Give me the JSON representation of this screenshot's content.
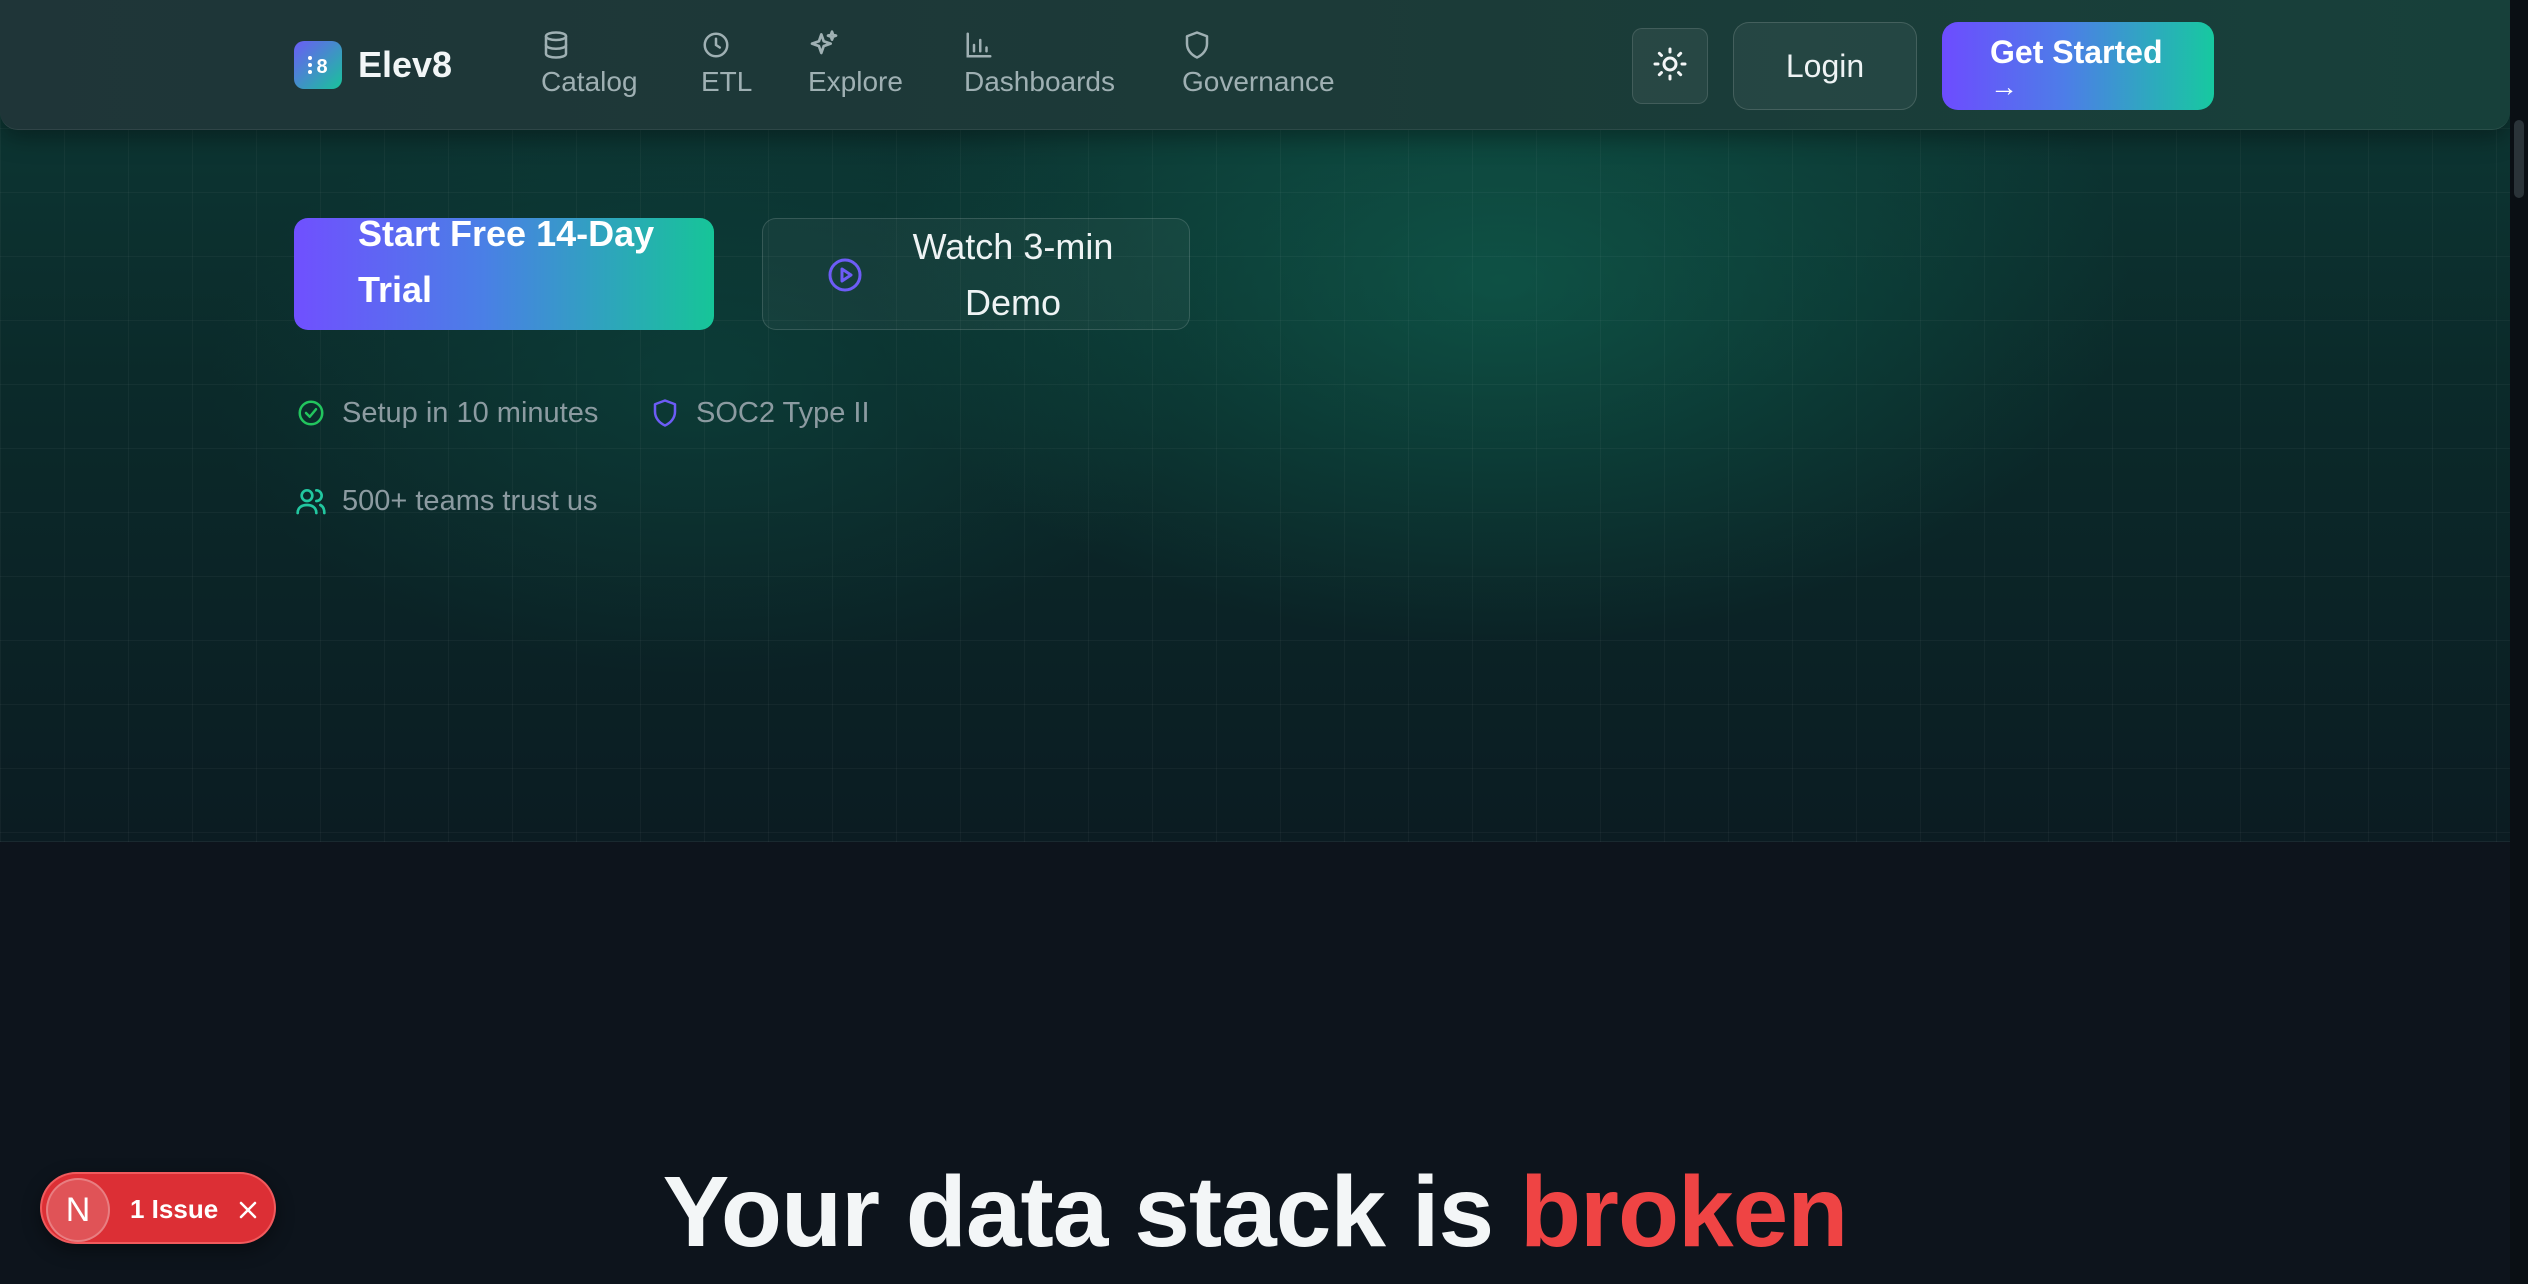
{
  "brand": {
    "name": "Elev8",
    "logo_icon": "elev8-logo-icon"
  },
  "nav": {
    "items": [
      {
        "label": "Catalog",
        "icon": "database-icon"
      },
      {
        "label": "ETL",
        "icon": "clock-icon"
      },
      {
        "label": "Explore",
        "icon": "sparkles-icon"
      },
      {
        "label": "Dashboards",
        "icon": "bar-chart-icon"
      },
      {
        "label": "Governance",
        "icon": "shield-icon"
      }
    ],
    "theme_toggle_icon": "sun-icon",
    "login_label": "Login",
    "get_started_label": "Get Started",
    "get_started_arrow": "→"
  },
  "hero": {
    "primary_cta": "Start Free 14-Day Trial",
    "primary_cta_arrow": "→",
    "secondary_cta": "Watch 3-min Demo",
    "secondary_cta_icon": "play-circle-icon",
    "trust": [
      {
        "text": "Setup in 10 minutes",
        "icon": "check-circle-icon"
      },
      {
        "text": "SOC2 Type II",
        "icon": "shield-icon"
      },
      {
        "text": "500+ teams trust us",
        "icon": "users-icon"
      }
    ]
  },
  "section": {
    "headline_prefix": "Your data stack is ",
    "headline_accent": "broken"
  },
  "dev_overlay": {
    "badge_letter": "N",
    "issue_label": "1 Issue",
    "close_icon": "close-icon"
  },
  "colors": {
    "accent_purple": "#6d4cff",
    "accent_green": "#17c9a0",
    "danger": "#ef4444",
    "background": "#0d141c"
  }
}
